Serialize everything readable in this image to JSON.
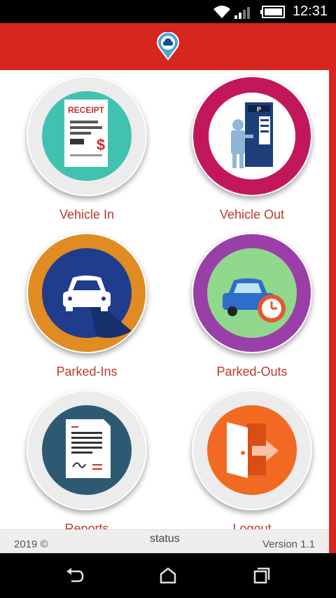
{
  "status_bar": {
    "time": "12:31",
    "icons": [
      "wifi-icon",
      "signal-icon",
      "battery-icon"
    ]
  },
  "app_bar": {
    "logo": "car-location-pin-icon",
    "color": "#d7261e"
  },
  "menu": [
    {
      "label": "Vehicle In",
      "icon": "receipt-icon"
    },
    {
      "label": "Vehicle Out",
      "icon": "parking-kiosk-icon"
    },
    {
      "label": "Parked-Ins",
      "icon": "car-icon"
    },
    {
      "label": "Parked-Outs",
      "icon": "car-clock-icon"
    },
    {
      "label": "Reports",
      "icon": "document-icon"
    },
    {
      "label": "Logout",
      "icon": "logout-door-icon"
    }
  ],
  "footer": {
    "copyright": "2019 ©",
    "status": "status",
    "version": "Version 1.1"
  },
  "nav_bar": {
    "buttons": [
      "back-icon",
      "home-icon",
      "recents-icon"
    ]
  }
}
